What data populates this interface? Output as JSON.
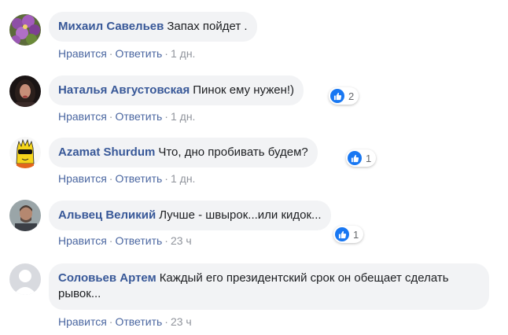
{
  "comments": [
    {
      "author": "Михаил Савельев",
      "text": "Запах пойдет .",
      "like_label": "Нравится",
      "reply_label": "Ответить",
      "time": "1 дн.",
      "reactions": null
    },
    {
      "author": "Наталья Августовская",
      "text": "Пинок ему нужен!)",
      "like_label": "Нравится",
      "reply_label": "Ответить",
      "time": "1 дн.",
      "reactions": "2"
    },
    {
      "author": "Azamat Shurdum",
      "text": "Что, дно пробивать будем?",
      "like_label": "Нравится",
      "reply_label": "Ответить",
      "time": "1 дн.",
      "reactions": "1"
    },
    {
      "author": "Альвец Великий",
      "text": "Лучше - швырок...или кидок...",
      "like_label": "Нравится",
      "reply_label": "Ответить",
      "time": "23 ч",
      "reactions": "1"
    },
    {
      "author": "Соловьев Артем",
      "text": "Каждый его президентский срок он обещает сделать рывок...",
      "like_label": "Нравится",
      "reply_label": "Ответить",
      "time": "23 ч",
      "reactions": null
    }
  ],
  "separator": "·",
  "colors": {
    "author": "#385898",
    "bubble": "#f2f3f5",
    "like_blue": "#1877f2"
  },
  "icons": {
    "reaction": "like-thumb-icon",
    "default_avatar": "default-avatar-icon"
  }
}
